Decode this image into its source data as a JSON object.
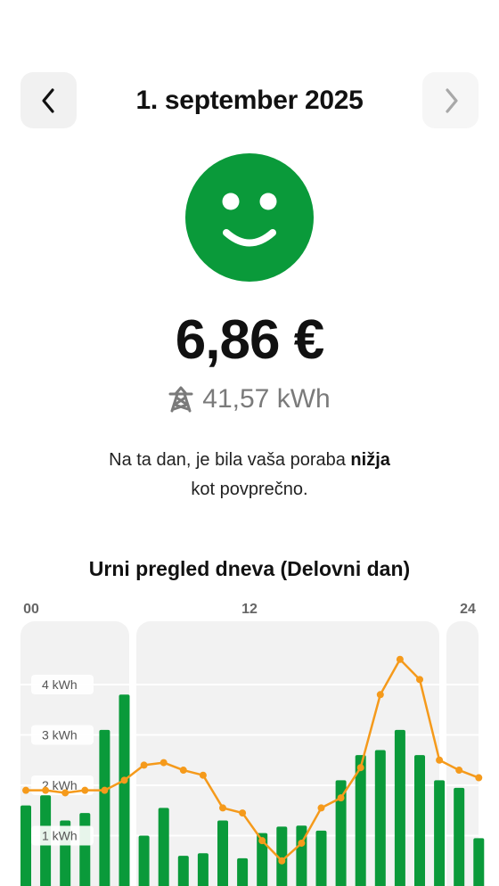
{
  "header": {
    "date": "1. september 2025",
    "prev_icon": "chevron-left-icon",
    "next_icon": "chevron-right-icon"
  },
  "summary": {
    "status_icon": "smiley-face-icon",
    "status_color": "#0a9a3a",
    "price": "6,86 €",
    "energy": "41,57 kWh",
    "energy_icon": "power-pylon-icon"
  },
  "message": {
    "before": "Na ta dan, je bila vaša poraba ",
    "bold": "nižja",
    "after": "kot povprečno."
  },
  "chart_data": {
    "type": "bar",
    "title": "Urni pregled dneva (Delovni dan)",
    "x_tick_labels": [
      "00",
      "12",
      "24"
    ],
    "y_tick_labels": [
      "1 kWh",
      "2 kWh",
      "3 kWh",
      "4 kWh"
    ],
    "ylim": [
      0,
      5.2
    ],
    "grid": true,
    "categories": [
      0,
      1,
      2,
      3,
      4,
      5,
      6,
      7,
      8,
      9,
      10,
      11,
      12,
      13,
      14,
      15,
      16,
      17,
      18,
      19,
      20,
      21,
      22,
      23
    ],
    "series": [
      {
        "type": "bar",
        "color": "#0a9a3a",
        "values": [
          1.6,
          1.8,
          1.3,
          1.45,
          3.1,
          3.8,
          1.0,
          1.55,
          0.6,
          0.65,
          1.3,
          0.55,
          1.05,
          1.18,
          1.2,
          1.1,
          2.1,
          2.6,
          2.7,
          3.1,
          2.6,
          2.1,
          1.95,
          0.95
        ]
      },
      {
        "type": "line",
        "color": "#f59a1b",
        "values": [
          1.9,
          1.9,
          1.85,
          1.9,
          1.9,
          2.1,
          2.4,
          2.45,
          2.3,
          2.2,
          1.55,
          1.45,
          0.9,
          0.5,
          0.85,
          1.55,
          1.75,
          2.35,
          3.8,
          4.5,
          4.1,
          2.5,
          2.3,
          2.15
        ]
      }
    ],
    "colors": {
      "bar": "#0a9a3a",
      "line": "#f59a1b",
      "panel": "#f2f2f2",
      "grid": "#ffffff"
    }
  }
}
